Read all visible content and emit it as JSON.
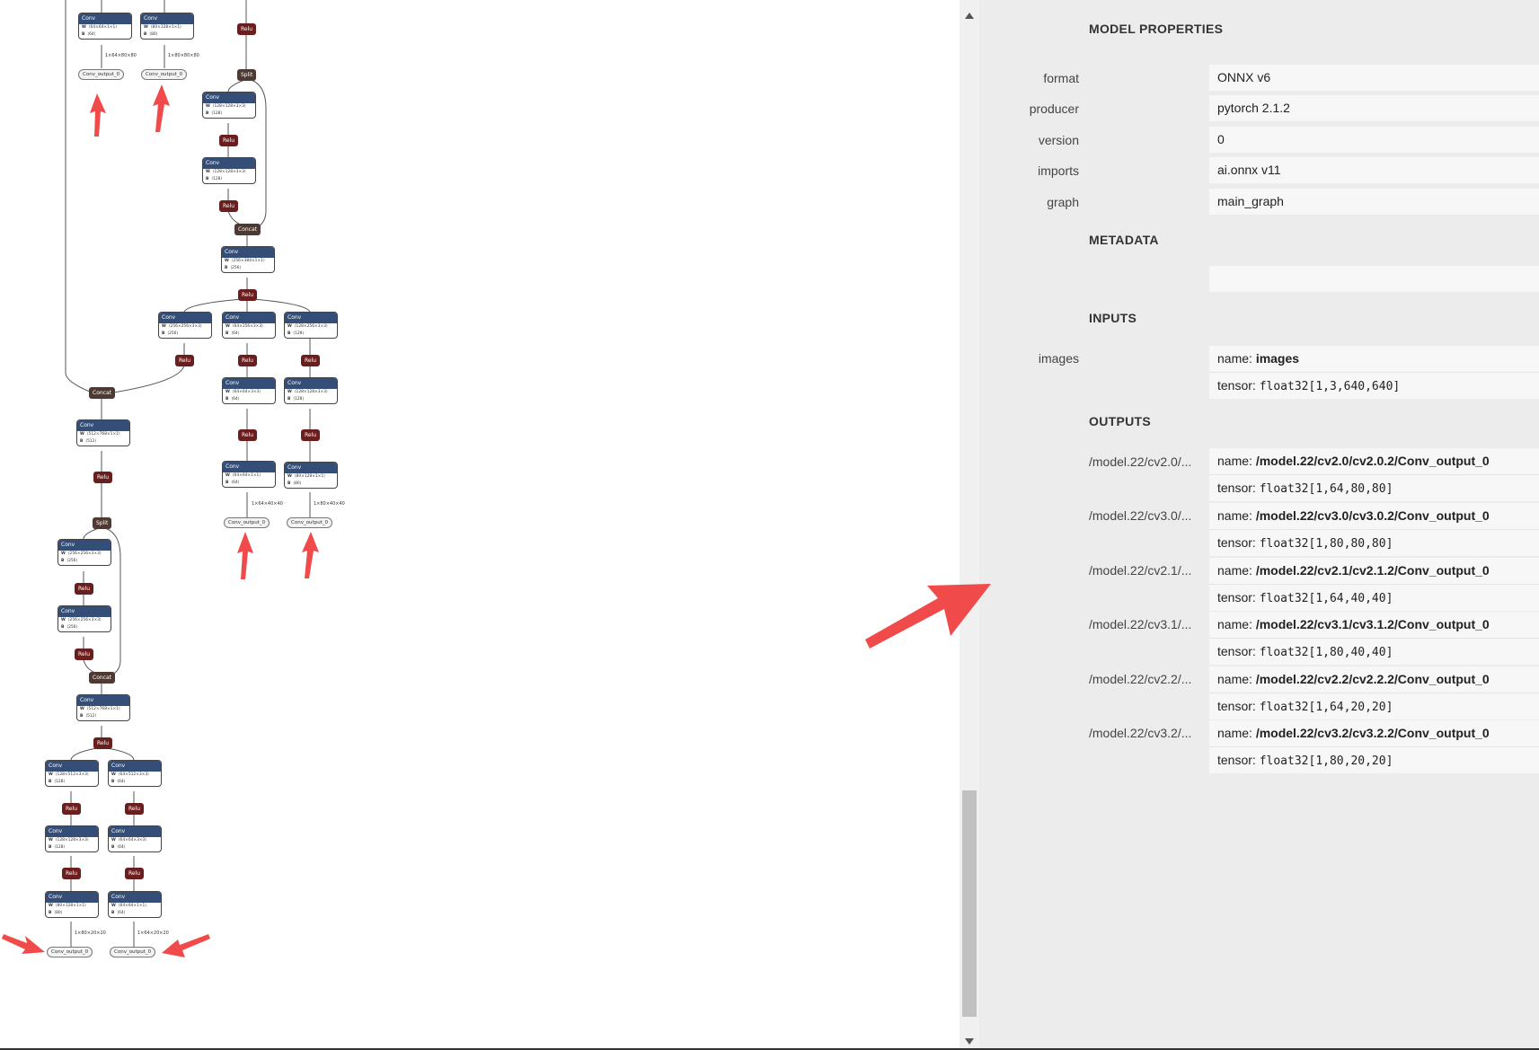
{
  "graph": {
    "op_conv": "Conv",
    "op_relu": "Relu",
    "op_split": "Split",
    "op_concat": "Concat",
    "w_key": "W",
    "b_key": "B",
    "output_name": "Conv_output_0",
    "conv_nodes": [
      {
        "w": "⟨64×64×1×1⟩",
        "b": "⟨64⟩"
      },
      {
        "w": "⟨80×128×1×1⟩",
        "b": "⟨80⟩"
      },
      {
        "w": "⟨128×128×3×3⟩",
        "b": "⟨128⟩"
      },
      {
        "w": "⟨128×128×3×3⟩",
        "b": "⟨128⟩"
      },
      {
        "w": "⟨256×384×1×1⟩",
        "b": "⟨256⟩"
      },
      {
        "w": "⟨256×256×3×3⟩",
        "b": "⟨256⟩"
      },
      {
        "w": "⟨64×256×3×3⟩",
        "b": "⟨64⟩"
      },
      {
        "w": "⟨128×256×3×3⟩",
        "b": "⟨128⟩"
      },
      {
        "w": "⟨64×64×3×3⟩",
        "b": "⟨64⟩"
      },
      {
        "w": "⟨128×128×3×3⟩",
        "b": "⟨128⟩"
      },
      {
        "w": "⟨512×768×1×1⟩",
        "b": "⟨512⟩"
      },
      {
        "w": "⟨64×64×1×1⟩",
        "b": "⟨64⟩"
      },
      {
        "w": "⟨80×128×1×1⟩",
        "b": "⟨80⟩"
      },
      {
        "w": "⟨256×256×3×3⟩",
        "b": "⟨256⟩"
      },
      {
        "w": "⟨256×256×3×3⟩",
        "b": "⟨256⟩"
      },
      {
        "w": "⟨512×768×1×1⟩",
        "b": "⟨512⟩"
      },
      {
        "w": "⟨128×512×3×3⟩",
        "b": "⟨128⟩"
      },
      {
        "w": "⟨64×512×3×3⟩",
        "b": "⟨64⟩"
      },
      {
        "w": "⟨128×128×3×3⟩",
        "b": "⟨128⟩"
      },
      {
        "w": "⟨64×64×3×3⟩",
        "b": "⟨64⟩"
      },
      {
        "w": "⟨80×128×1×1⟩",
        "b": "⟨80⟩"
      },
      {
        "w": "⟨64×64×1×1⟩",
        "b": "⟨64⟩"
      }
    ],
    "edge_labels": [
      "1×64×80×80",
      "1×80×80×80",
      "1×64×40×40",
      "1×80×40×40",
      "1×80×20×20",
      "1×64×20×20"
    ]
  },
  "panel": {
    "model_properties_title": "MODEL PROPERTIES",
    "properties": [
      {
        "label": "format",
        "value": "ONNX v6"
      },
      {
        "label": "producer",
        "value": "pytorch 2.1.2"
      },
      {
        "label": "version",
        "value": "0"
      },
      {
        "label": "imports",
        "value": "ai.onnx v11"
      },
      {
        "label": "graph",
        "value": "main_graph"
      }
    ],
    "metadata_title": "METADATA",
    "inputs_title": "INPUTS",
    "inputs": [
      {
        "label": "images",
        "name_key": "name:",
        "name": "images",
        "tensor_key": "tensor:",
        "tensor": "float32[1,3,640,640]"
      }
    ],
    "outputs_title": "OUTPUTS",
    "outputs": [
      {
        "label": "/model.22/cv2.0/...",
        "name_key": "name:",
        "name": "/model.22/cv2.0/cv2.0.2/Conv_output_0",
        "tensor_key": "tensor:",
        "tensor": "float32[1,64,80,80]"
      },
      {
        "label": "/model.22/cv3.0/...",
        "name_key": "name:",
        "name": "/model.22/cv3.0/cv3.0.2/Conv_output_0",
        "tensor_key": "tensor:",
        "tensor": "float32[1,80,80,80]"
      },
      {
        "label": "/model.22/cv2.1/...",
        "name_key": "name:",
        "name": "/model.22/cv2.1/cv2.1.2/Conv_output_0",
        "tensor_key": "tensor:",
        "tensor": "float32[1,64,40,40]"
      },
      {
        "label": "/model.22/cv3.1/...",
        "name_key": "name:",
        "name": "/model.22/cv3.1/cv3.1.2/Conv_output_0",
        "tensor_key": "tensor:",
        "tensor": "float32[1,80,40,40]"
      },
      {
        "label": "/model.22/cv2.2/...",
        "name_key": "name:",
        "name": "/model.22/cv2.2/cv2.2.2/Conv_output_0",
        "tensor_key": "tensor:",
        "tensor": "float32[1,64,20,20]"
      },
      {
        "label": "/model.22/cv3.2/...",
        "name_key": "name:",
        "name": "/model.22/cv3.2/cv3.2.2/Conv_output_0",
        "tensor_key": "tensor:",
        "tensor": "float32[1,80,20,20]"
      }
    ]
  },
  "colors": {
    "conv_header": "#344e78",
    "relu": "#6a1e1e",
    "split_concat": "#4e3a32",
    "annotation_arrow": "#f04a4a"
  }
}
